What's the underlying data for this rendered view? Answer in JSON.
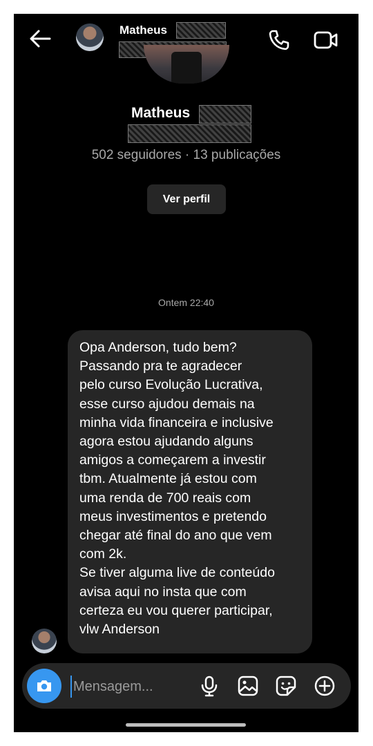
{
  "header": {
    "name": "Matheus"
  },
  "profile": {
    "name": "Matheus",
    "stats": "502 seguidores · 13 publicações",
    "view_profile_label": "Ver perfil"
  },
  "conversation": {
    "timestamp": "Ontem 22:40",
    "messages": [
      {
        "text": "Opa Anderson, tudo bem?\nPassando pra te agradecer\npelo curso Evolução Lucrativa,\nesse curso ajudou demais na\nminha vida financeira e inclusive\nagora estou ajudando alguns\namigos a começarem a investir\ntbm. Atualmente já estou com\numa renda de 700 reais com\nmeus investimentos e pretendo\nchegar até final do ano que vem\ncom 2k.\nSe tiver alguma live de conteúdo\navisa aqui no insta que com\ncerteza eu vou querer participar,\nvlw Anderson"
      }
    ]
  },
  "composer": {
    "placeholder": "Mensagem..."
  },
  "icons": {
    "back": "arrow-left-icon",
    "call": "phone-icon",
    "video": "video-camera-icon",
    "camera": "camera-icon",
    "mic": "microphone-icon",
    "gallery": "image-icon",
    "sticker": "sticker-icon",
    "add": "plus-circle-icon"
  },
  "colors": {
    "background": "#000000",
    "bubble": "#262626",
    "accent": "#3797f0",
    "secondary_text": "#a8a8a8"
  }
}
